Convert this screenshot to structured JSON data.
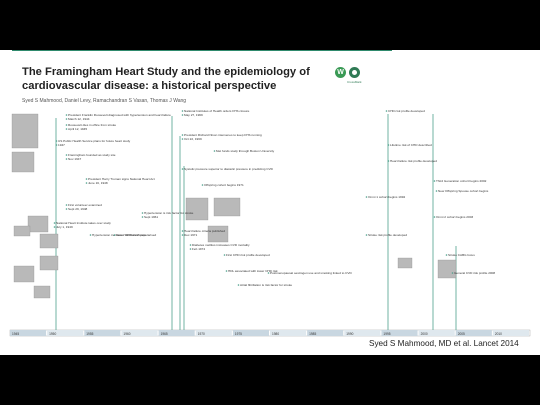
{
  "header": {
    "title_line1": "The Framingham Heart Study and the epidemiology of",
    "title_line2": "cardiovascular disease: a historical perspective",
    "authors": "Syed S Mahmood, Daniel Levy, Ramachandran S Vasan, Thomas J Wang",
    "logo_caption": "CrossMark"
  },
  "axis_years": [
    "1945",
    "1950",
    "1955",
    "1960",
    "1965",
    "1970",
    "1975",
    "1980",
    "1985",
    "1990",
    "1995",
    "2000",
    "2005",
    "2010"
  ],
  "events": [
    {
      "text": "President Franklin Roosevelt diagnosed with hypertension and heart failure"
    },
    {
      "text": "March 12, 1944"
    },
    {
      "text": "Roosevelt dies in office from stroke"
    },
    {
      "text": "April 12, 1945"
    },
    {
      "text": "US Public Health Service plans for future heart study"
    },
    {
      "text": "1947"
    },
    {
      "text": "Framingham founded as study site"
    },
    {
      "text": "Nov 1947"
    },
    {
      "text": "President Harry Truman signs National Heart Act"
    },
    {
      "text": "June 16, 1948"
    },
    {
      "text": "First volunteer examined"
    },
    {
      "text": "Sept 29, 1948"
    },
    {
      "text": "National Heart Institute takes over study"
    },
    {
      "text": "July 1, 1949"
    },
    {
      "text": "Hypertension increases CHD incidence"
    },
    {
      "text": "Term \"risk factor\" popularised"
    },
    {
      "text": "Hypertension is risk factor for stroke"
    },
    {
      "text": "Sept 1961"
    },
    {
      "text": "National Institutes of Health orders FHS closure"
    },
    {
      "text": "May 27, 1969"
    },
    {
      "text": "President Richard Nixon intervenes to keep FHS running"
    },
    {
      "text": "Oct 22, 1969"
    },
    {
      "text": "Met funds study through Boston University"
    },
    {
      "text": "Systolic pressure superior to diastolic pressure in predicting CVD"
    },
    {
      "text": "Offspring cohort begins 1971"
    },
    {
      "text": "Heart failure criteria published"
    },
    {
      "text": "Dec 1971"
    },
    {
      "text": "Diabetes mellitus increases CVD mortality"
    },
    {
      "text": "Feb 1974"
    },
    {
      "text": "First CHD risk profile developed"
    },
    {
      "text": "HDL associated with lower CHD risk"
    },
    {
      "text": "Atrial fibrillation is risk factor for stroke"
    },
    {
      "text": "Postmenopausal oestrogen use and smoking linked to CVD"
    },
    {
      "text": "Omni 1 cohort begins 1994"
    },
    {
      "text": "Stroke risk profile developed"
    },
    {
      "text": "CHD risk profile developed"
    },
    {
      "text": "Lifetime risk of CHD described"
    },
    {
      "text": "Heart failure risk profile developed"
    },
    {
      "text": "Third Generation cohort begins 2002"
    },
    {
      "text": "New Offspring Spouse cohort begins"
    },
    {
      "text": "Omni 2 cohort begins 2003"
    },
    {
      "text": "Stroke CABG focus"
    },
    {
      "text": "General CVD risk profile 2008"
    }
  ],
  "credit": "Syed S Mahmood, MD et al. Lancet 2014",
  "colors": {
    "accent": "#2f8a6d",
    "timeline_line": "#4fa08c",
    "bar": "#2f6d9e"
  }
}
